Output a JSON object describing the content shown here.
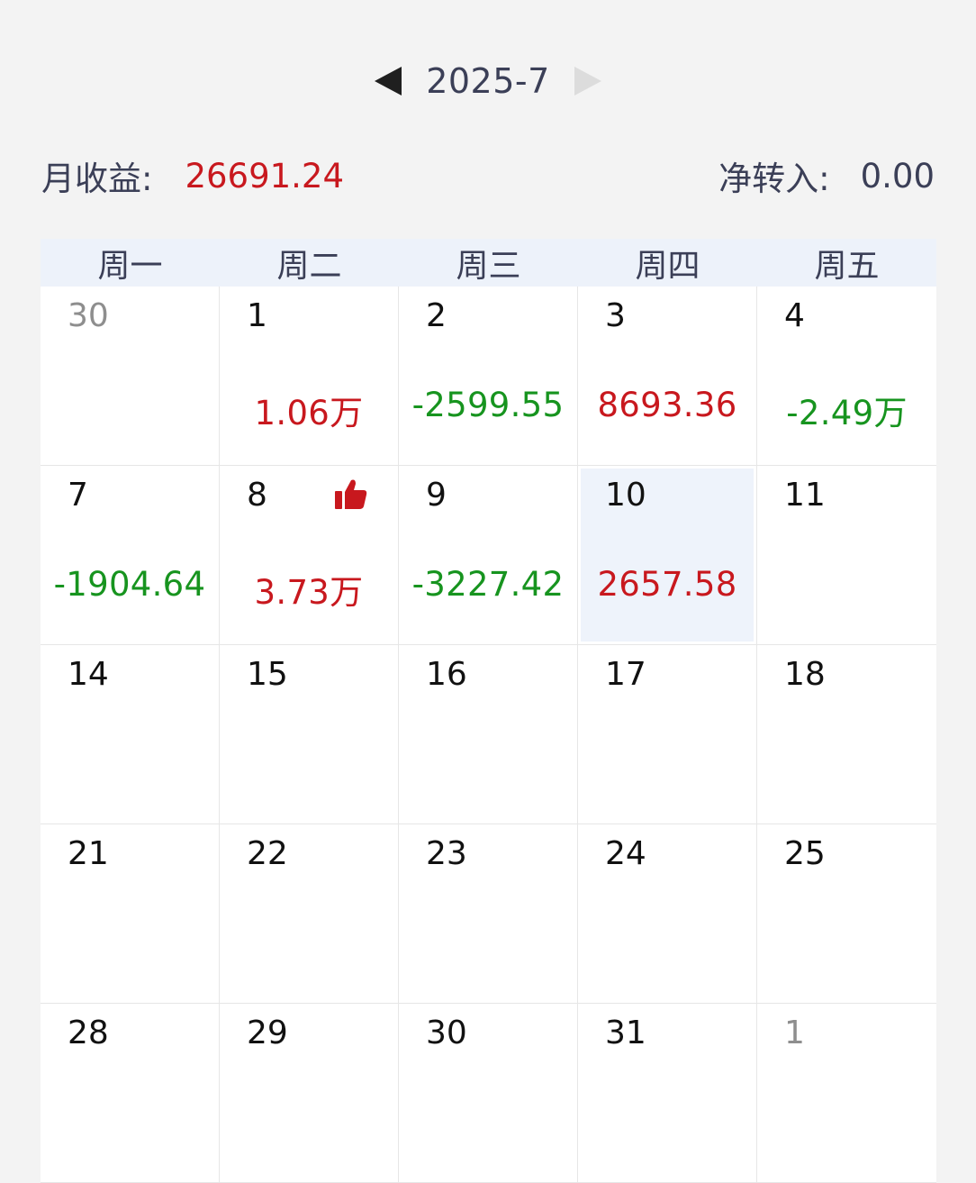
{
  "header": {
    "month": "2025-7",
    "prev_icon": "triangle-left-icon",
    "next_icon": "triangle-right-icon",
    "next_disabled": true
  },
  "summary": {
    "monthly_income_label": "月收益:",
    "monthly_income_value": "26691.24",
    "net_transfer_label": "净转入:",
    "net_transfer_value": "0.00"
  },
  "weekdays": [
    "周一",
    "周二",
    "周三",
    "周四",
    "周五"
  ],
  "colors": {
    "positive": "#c8181e",
    "negative": "#17941f",
    "selected_bg": "#eef3fb",
    "header_bg": "#edf2fa"
  },
  "days": [
    {
      "day": "30",
      "value": "",
      "other_month": true
    },
    {
      "day": "1",
      "value": "1.06万",
      "sign": "pos"
    },
    {
      "day": "2",
      "value": "-2599.55",
      "sign": "neg"
    },
    {
      "day": "3",
      "value": "8693.36",
      "sign": "pos"
    },
    {
      "day": "4",
      "value": "-2.49万",
      "sign": "neg"
    },
    {
      "day": "7",
      "value": "-1904.64",
      "sign": "neg"
    },
    {
      "day": "8",
      "value": "3.73万",
      "sign": "pos",
      "badge": "thumbs-up-icon"
    },
    {
      "day": "9",
      "value": "-3227.42",
      "sign": "neg"
    },
    {
      "day": "10",
      "value": "2657.58",
      "sign": "pos",
      "selected": true
    },
    {
      "day": "11",
      "value": ""
    },
    {
      "day": "14",
      "value": ""
    },
    {
      "day": "15",
      "value": ""
    },
    {
      "day": "16",
      "value": ""
    },
    {
      "day": "17",
      "value": ""
    },
    {
      "day": "18",
      "value": ""
    },
    {
      "day": "21",
      "value": ""
    },
    {
      "day": "22",
      "value": ""
    },
    {
      "day": "23",
      "value": ""
    },
    {
      "day": "24",
      "value": ""
    },
    {
      "day": "25",
      "value": ""
    },
    {
      "day": "28",
      "value": ""
    },
    {
      "day": "29",
      "value": ""
    },
    {
      "day": "30",
      "value": ""
    },
    {
      "day": "31",
      "value": ""
    },
    {
      "day": "1",
      "value": "",
      "other_month": true
    }
  ]
}
